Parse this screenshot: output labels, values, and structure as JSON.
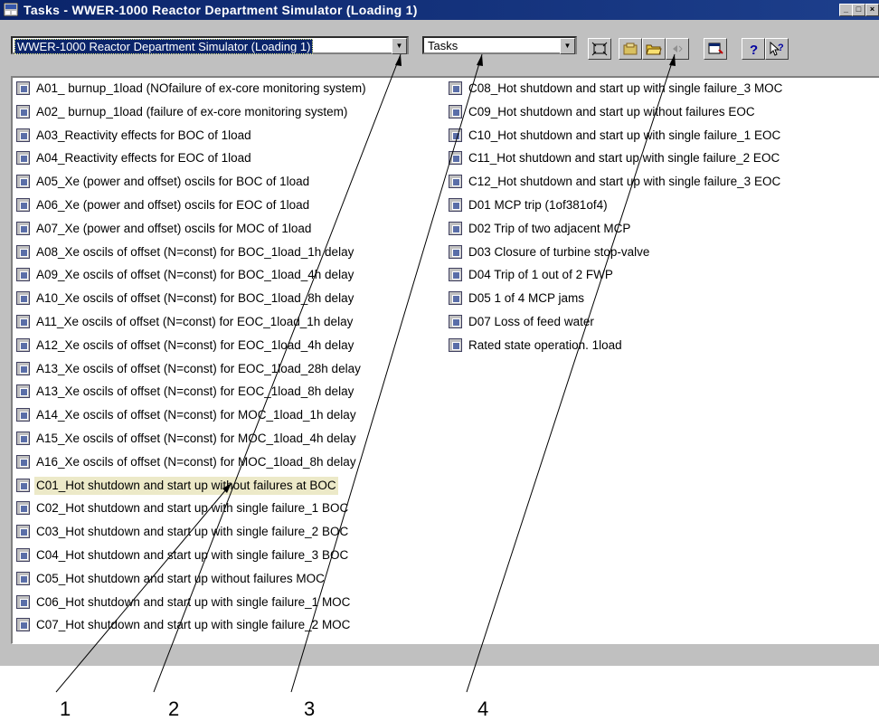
{
  "window": {
    "title": "Tasks - WWER-1000 Reactor Department Simulator (Loading 1)",
    "controls": [
      "_",
      "□",
      "×"
    ]
  },
  "toolbar": {
    "simulator_combo_value": "WWER-1000 Reactor Department Simulator (Loading 1)",
    "view_combo_value": "Tasks",
    "buttons": [
      "fit-icon",
      "library-icon",
      "open-folder-icon",
      "back-icon",
      "properties-icon",
      "help-icon",
      "context-help-icon"
    ]
  },
  "tasks_left": [
    "A01_ burnup_1load (NOfailure of ex-core monitoring system)",
    "A02_ burnup_1load (failure of ex-core monitoring system)",
    "A03_Reactivity effects for BOC of 1load",
    "A04_Reactivity effects for EOC of 1load",
    "A05_Xe (power and offset) oscils for BOC of 1load",
    "A06_Xe (power and offset) oscils for EOC of 1load",
    "A07_Xe (power and offset) oscils for MOC of 1load",
    "A08_Xe oscils of offset (N=const) for BOC_1load_1h delay",
    "A09_Xe oscils of offset (N=const) for BOC_1load_4h delay",
    "A10_Xe oscils of offset (N=const) for BOC_1load_8h delay",
    "A11_Xe oscils of offset (N=const) for EOC_1load_1h delay",
    "A12_Xe oscils of offset (N=const) for EOC_1load_4h delay",
    "A13_Xe oscils of offset (N=const) for EOC_1load_28h delay",
    "A13_Xe oscils of offset (N=const) for EOC_1load_8h delay",
    "A14_Xe oscils of offset (N=const) for MOC_1load_1h delay",
    "A15_Xe oscils of offset (N=const) for MOC_1load_4h delay",
    "A16_Xe oscils of offset (N=const) for MOC_1load_8h delay",
    "C01_Hot shutdown and start up without failures at BOC",
    "C02_Hot shutdown and start up with single failure_1 BOC",
    "C03_Hot shutdown and start up with single failure_2 BOC",
    "C04_Hot shutdown and start up with single failure_3 BOC",
    "C05_Hot shutdown and start up without failures MOC",
    "C06_Hot shutdown and start up with single failure_1 MOC",
    "C07_Hot shutdown and start up with single failure_2 MOC"
  ],
  "tasks_right": [
    "C08_Hot shutdown and start up with single failure_3 MOC",
    "C09_Hot shutdown and start up without failures EOC",
    "C10_Hot shutdown and start up with single failure_1 EOC",
    "C11_Hot shutdown and start up with single failure_2 EOC",
    "C12_Hot shutdown and start up with single failure_3 EOC",
    "D01 MCP trip (1of381of4)",
    "D02 Trip of two adjacent MCP",
    "D03 Closure of turbine stop-valve",
    "D04 Trip of 1 out of 2 FWP",
    "D05 1 of 4 MCP jams",
    "D07 Loss of feed water",
    "Rated state operation. 1load"
  ],
  "selected_task": "C01_Hot shutdown and start up without failures at BOC",
  "callouts": [
    "1",
    "2",
    "3",
    "4"
  ]
}
